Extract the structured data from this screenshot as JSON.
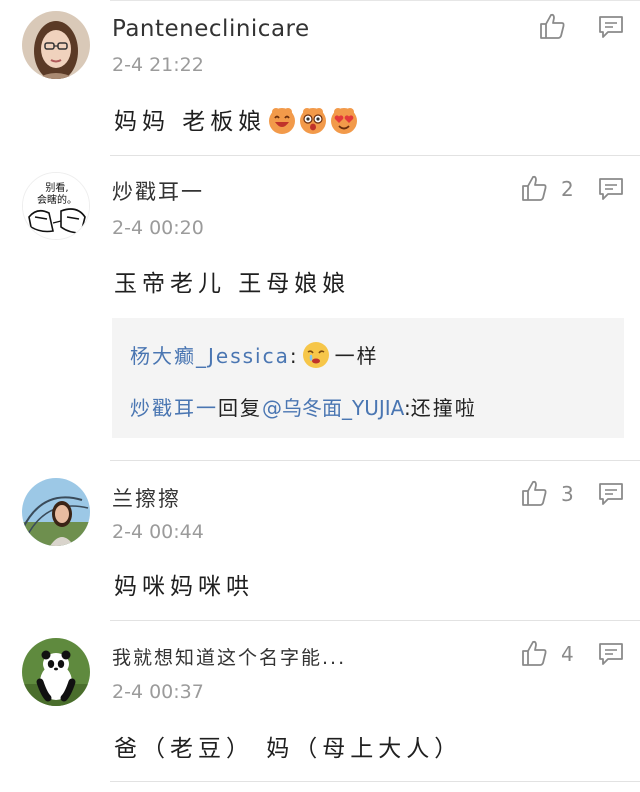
{
  "comments": [
    {
      "username": "Panteneclinicare",
      "time": "2-4 21:22",
      "text": "妈妈 老板娘",
      "emojis": [
        "laughing-face-emoji",
        "surprised-face-emoji",
        "heart-eyes-face-emoji"
      ],
      "like_count": "",
      "avatar": "woman-portrait-avatar"
    },
    {
      "username": "炒戳耳一",
      "time": "2-4 00:20",
      "text": "玉帝老儿 王母娘娘",
      "like_count": "2",
      "avatar": "cartoon-avatar",
      "avatar_text": [
        "别看,",
        "会瞎的。"
      ],
      "replies": [
        {
          "name": "杨大癫_Jessica",
          "separator": ":",
          "emoji": "crying-face-emoji",
          "text": "一样"
        },
        {
          "name": "炒戳耳一",
          "action": "回复",
          "mention": "@乌冬面_YUJIA",
          "separator": ":",
          "text": "还撞啦"
        }
      ]
    },
    {
      "username": "兰擦擦",
      "time": "2-4 00:44",
      "text": "妈咪妈咪哄",
      "like_count": "3",
      "avatar": "girl-outdoor-avatar"
    },
    {
      "username": "我就想知道这个名字能...",
      "time": "2-4 00:37",
      "text": "爸（老豆） 妈（母上大人）",
      "like_count": "4",
      "avatar": "panda-avatar"
    }
  ],
  "icons": {
    "like": "thumbs-up-icon",
    "reply": "comment-icon"
  },
  "colors": {
    "link": "#4a76b2",
    "timestamp": "#9b9b9b",
    "reply_bg": "#f4f4f4",
    "divider": "#e2e2e2"
  }
}
